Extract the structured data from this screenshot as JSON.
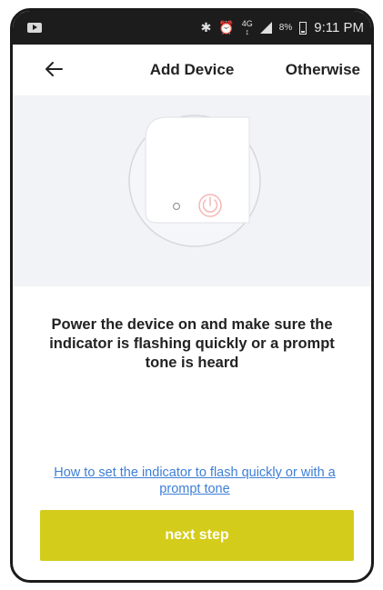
{
  "status_bar": {
    "icons": [
      "media-icon",
      "bluetooth-icon",
      "alarm-icon",
      "network-4g-icon",
      "signal-icon",
      "battery-icon"
    ],
    "network_label": "4G",
    "battery": "8%",
    "time": "9:11 PM"
  },
  "header": {
    "back_icon": "arrow-left-icon",
    "title": "Add Device",
    "right_action": "Otherwise"
  },
  "illustration": {
    "icons": [
      "indicator-light-icon",
      "power-icon"
    ]
  },
  "instruction": "Power the device on and make sure the indicator is flashing quickly or a prompt tone is heard",
  "help_link": "How to set the indicator to flash quickly or with a  prompt tone",
  "primary_button": "next step",
  "colors": {
    "accent": "#d4cc1a",
    "link": "#3d7fd6",
    "status_bar_bg": "#1c1c1c",
    "illustration_bg": "#f2f3f6",
    "power_icon": "#f3b8b6"
  }
}
